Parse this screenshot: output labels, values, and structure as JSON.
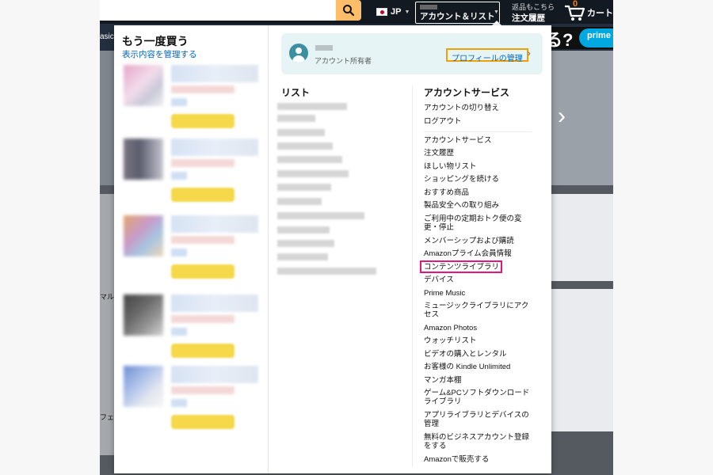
{
  "header": {
    "lang_label": "JP",
    "account_label": "アカウント＆リスト",
    "orders_line1": "返品もこちら",
    "orders_line2": "注文履歴",
    "cart_count": "0",
    "cart_label": "カート"
  },
  "subnav": {
    "left_fragment": "asic",
    "banner_fragment": "る?",
    "prime_label": "prime"
  },
  "background": {
    "text_fragment_1": "マルテ",
    "text_fragment_2": "フェク"
  },
  "buy_again": {
    "title": "もう一度買う",
    "manage_link": "表示内容を管理する"
  },
  "profile": {
    "role": "アカウント所有者",
    "manage_label": "プロフィールの管理"
  },
  "list": {
    "title": "リスト"
  },
  "account_services": {
    "title": "アカウントサービス",
    "top_items": [
      "アカウントの切り替え",
      "ログアウト"
    ],
    "items": [
      "アカウントサービス",
      "注文履歴",
      "ほしい物リスト",
      "ショッピングを続ける",
      "おすすめ商品",
      "製品安全への取り組み",
      "ご利用中の定期おトク便の変",
      "更・停止",
      "メンバーシップおよび購読",
      "Amazonプライム会員情報",
      "コンテンツライブラリ",
      "デバイス",
      "Prime Music",
      "ミュージックライブラリにアク",
      "セス",
      "Amazon Photos",
      "ウォッチリスト",
      "ビデオの購入とレンタル",
      "お客様の Kindle Unlimited",
      "マンガ本棚",
      "ゲーム&PCソフトダウンロード",
      "ライブラリ",
      "アプリライブラリとデバイスの",
      "管理",
      "無料のビジネスアカウント登録",
      "をする",
      "Amazonで販売する"
    ]
  },
  "colors": {
    "header_bg": "#131921",
    "subnav_bg": "#232f3e",
    "search_button": "#febd69",
    "link": "#0066c0",
    "profile_highlight": "#f0a000",
    "content_library_highlight": "#e3177c"
  },
  "icons": [
    "search-icon",
    "flag-icon",
    "cart-icon",
    "avatar-icon",
    "chevron-right-icon"
  ]
}
